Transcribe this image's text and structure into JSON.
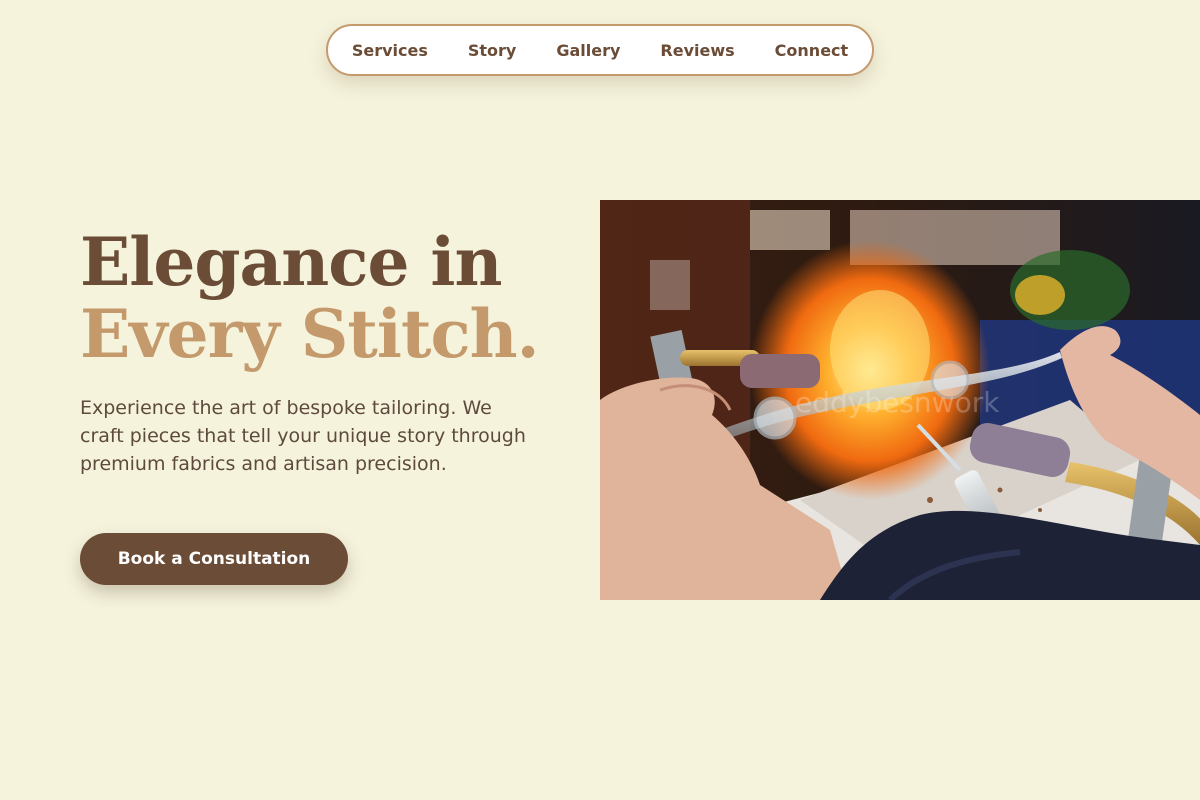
{
  "nav": {
    "items": [
      {
        "label": "Services"
      },
      {
        "label": "Story"
      },
      {
        "label": "Gallery"
      },
      {
        "label": "Reviews"
      },
      {
        "label": "Connect"
      }
    ]
  },
  "hero": {
    "title_line_1": "Elegance in",
    "title_line_2": "Every Stitch.",
    "description": "Experience the art of bespoke tailoring. We craft pieces that tell your unique story through premium fabrics and artisan precision.",
    "cta_label": "Book a Consultation",
    "image": {
      "subject": "glassblowing-photo",
      "watermark": "eddybesnwork"
    }
  },
  "colors": {
    "background": "#f5f3dc",
    "brand_dark": "#6b4c36",
    "brand_accent": "#c49a6c",
    "nav_bg": "#ffffff"
  }
}
